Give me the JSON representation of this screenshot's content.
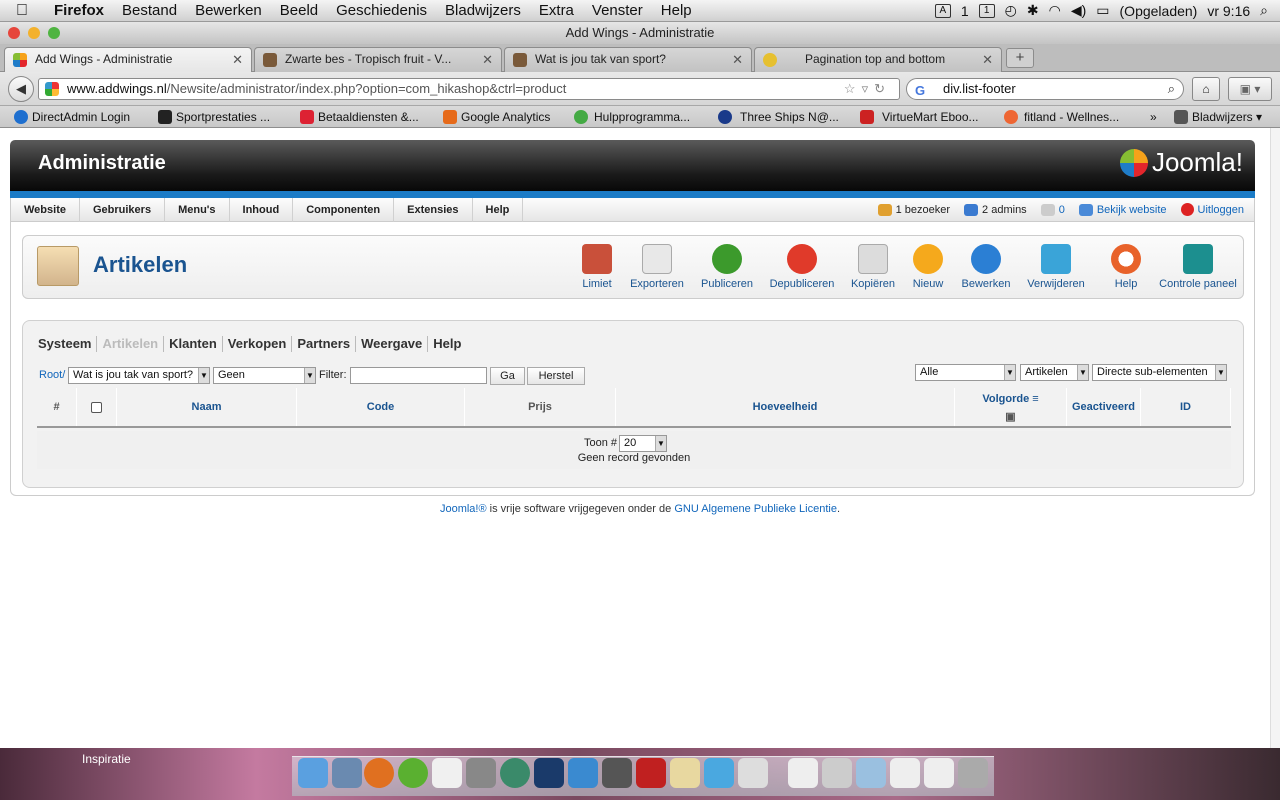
{
  "menubar": {
    "apple": "",
    "items": [
      "Firefox",
      "Bestand",
      "Bewerken",
      "Beeld",
      "Geschiedenis",
      "Bladwijzers",
      "Extra",
      "Venster",
      "Help"
    ],
    "status": {
      "num": "1",
      "battery": "(Opgeladen)",
      "clock": "vr 9:16"
    }
  },
  "window": {
    "title": "Add Wings - Administratie"
  },
  "tabs": [
    {
      "label": "Add Wings - Administratie",
      "color": "#e6a030"
    },
    {
      "label": "Zwarte bes - Tropisch fruit - V...",
      "color": "#7a5a3a"
    },
    {
      "label": "Wat is jou tak van sport?",
      "color": "#7a5a3a"
    },
    {
      "label": "Pagination top and bottom",
      "color": "#e6c030"
    }
  ],
  "nav": {
    "url_domain": "www.addwings.nl",
    "url_path": "/Newsite/administrator/index.php?option=com_hikashop&ctrl=product",
    "search_value": "div.list-footer",
    "search_engine": "G"
  },
  "bookmarks": [
    {
      "label": "DirectAdmin Login",
      "color": "#1e6fcf"
    },
    {
      "label": "Sportprestaties ...",
      "color": "#222"
    },
    {
      "label": "Betaaldiensten &...",
      "color": "#d23"
    },
    {
      "label": "Google Analytics",
      "color": "#e66a1a"
    },
    {
      "label": "Hulpprogramma...",
      "color": "#4a4"
    },
    {
      "label": "Three Ships N@...",
      "color": "#1a3a8a"
    },
    {
      "label": "VirtueMart Eboo...",
      "color": "#c22"
    },
    {
      "label": "fitland - Wellnes...",
      "color": "#e63"
    }
  ],
  "bookmarks_more": "»",
  "bookmarks_menu": "Bladwijzers",
  "joomla": {
    "header_title": "Administratie",
    "logo_text": "Joomla!",
    "menu": [
      "Website",
      "Gebruikers",
      "Menu's",
      "Inhoud",
      "Componenten",
      "Extensies",
      "Help"
    ],
    "status": {
      "visitors": "1 bezoeker",
      "admins": "2 admins",
      "messages": "0",
      "view_site": "Bekijk website",
      "logout": "Uitloggen"
    },
    "page_title": "Artikelen",
    "toolbar": [
      {
        "label": "Limiet",
        "icon": "limit-icon",
        "color": "#c9503a"
      },
      {
        "label": "Exporteren",
        "icon": "export-icon",
        "color": "#e8e8e8"
      },
      {
        "label": "Publiceren",
        "icon": "publish-icon",
        "color": "#3c9a2c"
      },
      {
        "label": "Depubliceren",
        "icon": "unpublish-icon",
        "color": "#e03a2a"
      },
      {
        "label": "Kopiëren",
        "icon": "copy-icon",
        "color": "#dcdcdc"
      },
      {
        "label": "Nieuw",
        "icon": "new-icon",
        "color": "#f5a91c"
      },
      {
        "label": "Bewerken",
        "icon": "edit-icon",
        "color": "#2b7fd4"
      },
      {
        "label": "Verwijderen",
        "icon": "delete-icon",
        "color": "#3aa4d8"
      },
      {
        "label": "Help",
        "icon": "help-icon",
        "color": "#e8622a"
      },
      {
        "label": "Controle paneel",
        "icon": "control-panel-icon",
        "color": "#1c8f8f"
      }
    ],
    "subnav": [
      {
        "label": "Systeem",
        "enabled": true
      },
      {
        "label": "Artikelen",
        "enabled": false
      },
      {
        "label": "Klanten",
        "enabled": true
      },
      {
        "label": "Verkopen",
        "enabled": true
      },
      {
        "label": "Partners",
        "enabled": true
      },
      {
        "label": "Weergave",
        "enabled": true
      },
      {
        "label": "Help",
        "enabled": true
      }
    ],
    "filters": {
      "root_label": "Root/",
      "category_value": "Wat is jou tak van sport?",
      "geen_value": "Geen",
      "filter_label": "Filter:",
      "filter_value": "",
      "go_label": "Ga",
      "reset_label": "Herstel",
      "alle_value": "Alle",
      "type_value": "Artikelen",
      "children_value": "Directe sub-elementen"
    },
    "table": {
      "headers": [
        "#",
        "",
        "Naam",
        "Code",
        "Prijs",
        "Hoeveelheid",
        "Volgorde",
        "Geactiveerd",
        "ID"
      ],
      "show_label": "Toon #",
      "show_value": "20",
      "empty_text": "Geen record gevonden"
    },
    "footer": {
      "prefix": "Joomla!®",
      "middle": " is vrije software vrijgegeven onder de ",
      "link": "GNU Algemene Publieke Licentie",
      "suffix": "."
    }
  },
  "dock": {
    "label": "Inspiratie"
  }
}
